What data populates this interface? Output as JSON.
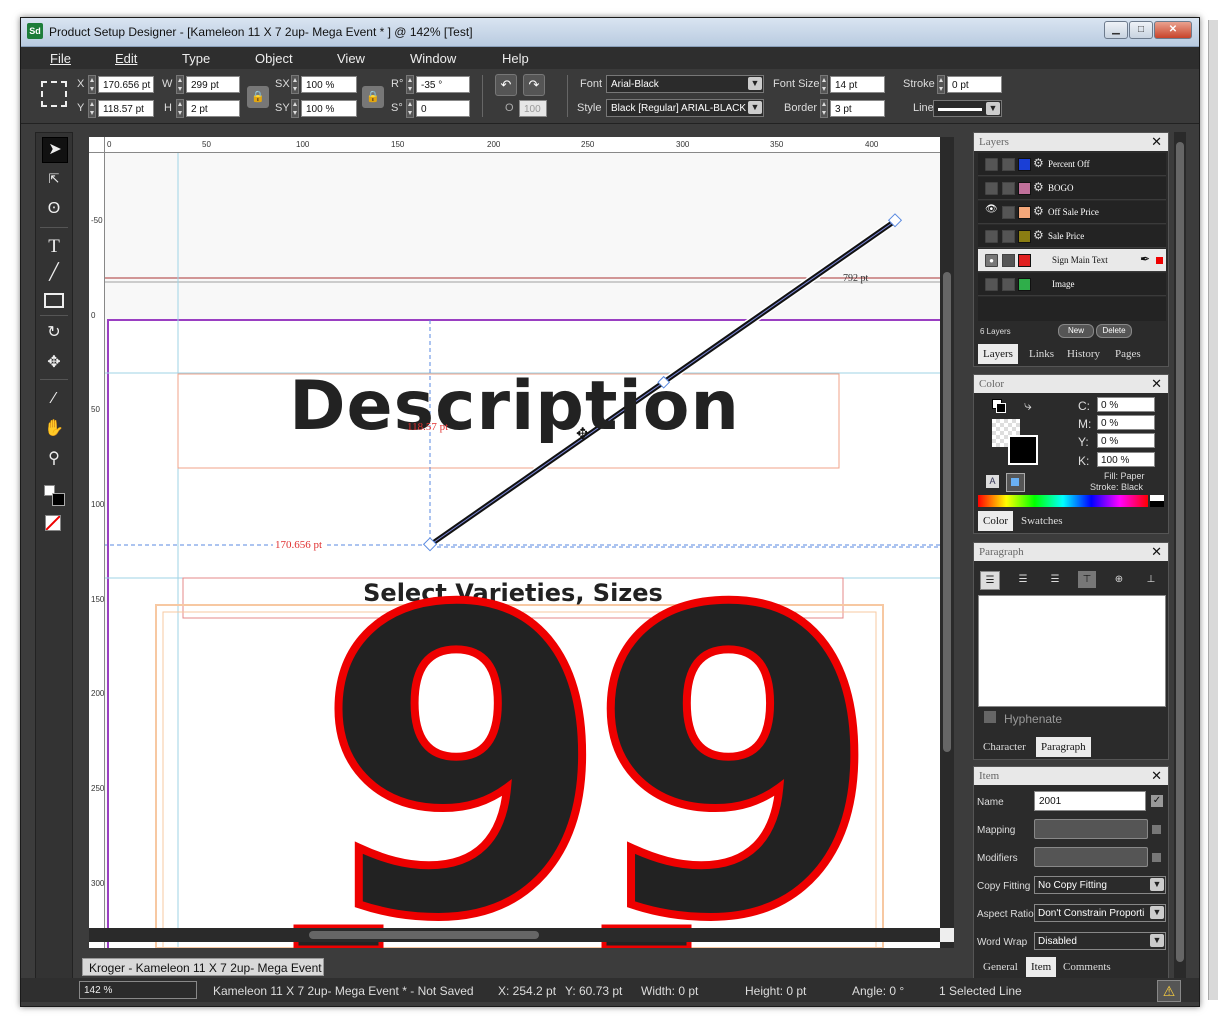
{
  "window": {
    "title": "Product Setup Designer - [Kameleon 11 X 7 2up- Mega Event * ] @ 142% [Test]",
    "app_icon": "Sd",
    "controls": [
      "minimize-icon",
      "maximize-icon",
      "close-icon"
    ]
  },
  "menu": [
    "File",
    "Edit",
    "Type",
    "Object",
    "View",
    "Window",
    "Help"
  ],
  "controls": {
    "x_label": "X",
    "x_value": "170.656 pt",
    "y_label": "Y",
    "y_value": "118.57 pt",
    "w_label": "W",
    "w_value": "299 pt",
    "h_label": "H",
    "h_value": "2 pt",
    "sx_label": "SX",
    "sx_value": "100 %",
    "sy_label": "SY",
    "sy_value": "100 %",
    "r_label": "R°",
    "r_value": "-35 °",
    "s_label": "S°",
    "s_value": "0",
    "o_label": "O",
    "o_value": "100",
    "font_label": "Font",
    "font_value": "Arial-Black",
    "style_label": "Style",
    "style_value": "Black [Regular] ARIAL-BLACK",
    "fontsize_label": "Font Size",
    "fontsize_value": "14 pt",
    "border_label": "Border",
    "border_value": "3 pt",
    "stroke_label": "Stroke",
    "stroke_value": "0 pt",
    "line_label": "Line"
  },
  "tools": [
    "select-arrow-icon",
    "direct-select-icon",
    "lasso-icon",
    "text-tool-icon",
    "line-tool-icon",
    "rectangle-tool-icon",
    "rotate-icon",
    "move-icon",
    "eyedropper-icon",
    "hand-icon",
    "zoom-icon",
    "fill-stroke-icon",
    "none-swatch-icon"
  ],
  "ruler": {
    "top": [
      "0",
      "50",
      "100",
      "150",
      "200",
      "250",
      "300",
      "350",
      "400"
    ],
    "left": [
      "-50",
      "0",
      "50",
      "100",
      "150",
      "200",
      "250",
      "300"
    ]
  },
  "canvas": {
    "line_length_label": "792 pt",
    "y_measure": "118.57 pt",
    "x_measure": "170.656 pt",
    "description_text": "Description",
    "varieties_text": "Select Varieties, Sizes",
    "price_text": "99"
  },
  "doc_tab": "Kroger - Kameleon 11 X 7 2up- Mega Event",
  "status": {
    "zoom": "142 %",
    "doc": "Kameleon 11 X 7 2up- Mega Event  * - Not Saved",
    "x": "X: 254.2 pt",
    "y": "Y: 60.73 pt",
    "width": "Width: 0 pt",
    "height": "Height: 0 pt",
    "angle": "Angle: 0 °",
    "selection": "1 Selected Line"
  },
  "layers_panel": {
    "title": "Layers",
    "layers": [
      {
        "name": "Percent Off",
        "color": "#1a3fd6"
      },
      {
        "name": "BOGO",
        "color": "#c0709a"
      },
      {
        "name": "Off Sale Price",
        "color": "#f4a77a"
      },
      {
        "name": "Sale Price",
        "color": "#8a7d12"
      },
      {
        "name": "Sign Main Text",
        "color": "#e02020"
      },
      {
        "name": "Image",
        "color": "#2fae4a"
      }
    ],
    "count": "6 Layers",
    "new_btn": "New",
    "delete_btn": "Delete",
    "tabs": [
      "Layers",
      "Links",
      "History",
      "Pages"
    ]
  },
  "color_panel": {
    "title": "Color",
    "c_label": "C:",
    "c_value": "0 %",
    "m_label": "M:",
    "m_value": "0 %",
    "y_label": "Y:",
    "y_value": "0 %",
    "k_label": "K:",
    "k_value": "100 %",
    "fill": "Fill: Paper",
    "stroke": "Stroke: Black",
    "tabs": [
      "Color",
      "Swatches"
    ]
  },
  "paragraph_panel": {
    "title": "Paragraph",
    "hyphenate": "Hyphenate",
    "tabs": [
      "Character",
      "Paragraph"
    ]
  },
  "item_panel": {
    "title": "Item",
    "name_label": "Name",
    "name_value": "2001",
    "mapping_label": "Mapping",
    "modifiers_label": "Modifiers",
    "copyfit_label": "Copy Fitting",
    "copyfit_value": "No Copy Fitting",
    "aspect_label": "Aspect Ratio",
    "aspect_value": "Don't Constrain Proporti",
    "wrap_label": "Word Wrap",
    "wrap_value": "Disabled",
    "tabs": [
      "General",
      "Item",
      "Comments"
    ]
  }
}
